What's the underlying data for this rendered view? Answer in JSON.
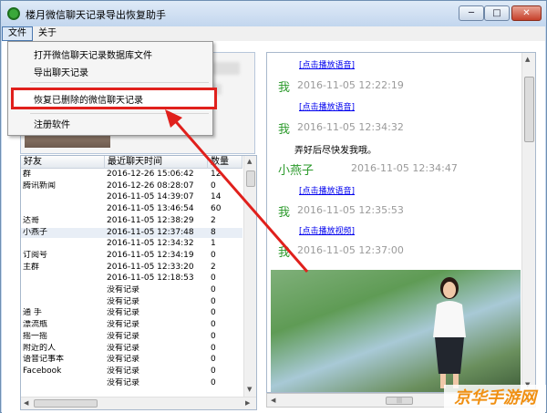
{
  "window": {
    "title": "楼月微信聊天记录导出恢复助手",
    "minimize_glyph": "─",
    "maximize_glyph": "□",
    "close_glyph": "✕"
  },
  "menubar": {
    "file": "文件",
    "about": "关于"
  },
  "file_menu": {
    "items": [
      "打开微信聊天记录数据库文件",
      "导出聊天记录",
      "恢复已删除的微信聊天记录",
      "注册软件"
    ],
    "highlighted_index": 2
  },
  "contacts": {
    "headers": [
      "好友",
      "最近聊天时间",
      "数量"
    ],
    "rows": [
      {
        "name": "  群",
        "time": "2016-12-26 15:06:42",
        "count": "12"
      },
      {
        "name": "腾讯新闻",
        "time": "2016-12-26 08:28:07",
        "count": "0"
      },
      {
        "name": "",
        "time": "2016-11-05 14:39:07",
        "count": "14"
      },
      {
        "name": "",
        "time": "2016-11-05 13:46:54",
        "count": "60"
      },
      {
        "name": "达哥",
        "time": "2016-11-05 12:38:29",
        "count": "2"
      },
      {
        "name": "小燕子",
        "time": "2016-11-05 12:37:48",
        "count": "8"
      },
      {
        "name": "",
        "time": "2016-11-05 12:34:32",
        "count": "1"
      },
      {
        "name": "订阅号",
        "time": "2016-11-05 12:34:19",
        "count": "0"
      },
      {
        "name": "  主群",
        "time": "2016-11-05 12:33:20",
        "count": "2"
      },
      {
        "name": "",
        "time": "2016-11-05 12:18:53",
        "count": "0"
      },
      {
        "name": "",
        "time": "没有记录",
        "count": "0"
      },
      {
        "name": "",
        "time": "没有记录",
        "count": "0"
      },
      {
        "name": "通  手",
        "time": "没有记录",
        "count": "0"
      },
      {
        "name": "漂流瓶",
        "time": "没有记录",
        "count": "0"
      },
      {
        "name": "摇一摇",
        "time": "没有记录",
        "count": "0"
      },
      {
        "name": "附近的人",
        "time": "没有记录",
        "count": "0"
      },
      {
        "name": "语音记事本",
        "time": "没有记录",
        "count": "0"
      },
      {
        "name": "Facebook",
        "time": "没有记录",
        "count": "0"
      },
      {
        "name": "",
        "time": "没有记录",
        "count": "0"
      }
    ],
    "selected_index": 5
  },
  "chat": {
    "entries": [
      {
        "kind": "link",
        "text": "[点击播放语音]"
      },
      {
        "kind": "header",
        "speaker": "我",
        "time": "2016-11-05 12:22:19"
      },
      {
        "kind": "link",
        "text": "[点击播放语音]"
      },
      {
        "kind": "header",
        "speaker": "我",
        "time": "2016-11-05 12:34:32"
      },
      {
        "kind": "message",
        "text": "弄好后尽快发我哦。"
      },
      {
        "kind": "header",
        "speaker": "小燕子",
        "time": "2016-11-05 12:34:47"
      },
      {
        "kind": "link",
        "text": "[点击播放语音]"
      },
      {
        "kind": "header",
        "speaker": "我",
        "time": "2016-11-05 12:35:53"
      },
      {
        "kind": "link",
        "text": "[点击播放视频]"
      },
      {
        "kind": "header",
        "speaker": "我",
        "time": "2016-11-05 12:37:00"
      }
    ]
  },
  "watermark": "京华手游网",
  "colors": {
    "highlight_box": "#e0201c",
    "speaker_green": "#2c9a2c",
    "link_blue": "#0000ee",
    "timestamp_gray": "#9a9a9a",
    "watermark_orange": "#f09013"
  },
  "icons": {
    "app": "app-logo-icon",
    "minimize": "minimize-icon",
    "maximize": "maximize-icon",
    "close": "close-icon"
  }
}
